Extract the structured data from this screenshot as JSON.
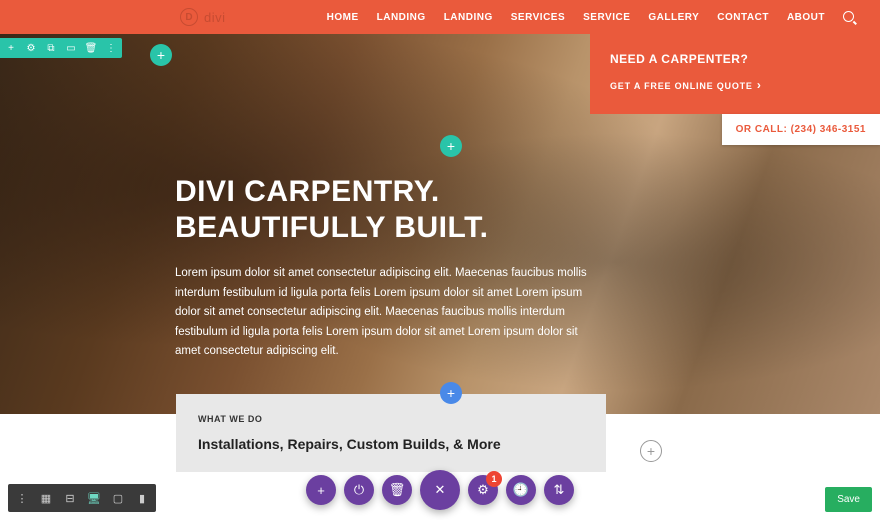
{
  "brand": {
    "name": "divi"
  },
  "nav": [
    "HOME",
    "LANDING",
    "LANDING",
    "SERVICES",
    "SERVICE",
    "GALLERY",
    "CONTACT",
    "ABOUT"
  ],
  "cta": {
    "title": "NEED A CARPENTER?",
    "link": "GET A FREE ONLINE QUOTE"
  },
  "call": "OR CALL: (234) 346-3151",
  "hero": {
    "heading": "DIVI CARPENTRY. BEAUTIFULLY BUILT.",
    "body": "Lorem ipsum dolor sit amet consectetur adipiscing elit. Maecenas faucibus mollis interdum festibulum id ligula porta felis Lorem ipsum dolor sit amet Lorem ipsum dolor sit amet consectetur adipiscing elit. Maecenas faucibus mollis interdum festibulum id ligula porta felis Lorem ipsum dolor sit amet Lorem ipsum dolor sit amet consectetur adipiscing elit."
  },
  "sub": {
    "kicker": "WHAT WE DO",
    "title": "Installations, Repairs, Custom Builds, & More"
  },
  "badge": "1",
  "save": "Save",
  "colors": {
    "primary": "#ea5a3c",
    "teal": "#29c4a9",
    "purple": "#6b3fa0",
    "blue": "#4989e8",
    "green": "#27ae60"
  }
}
